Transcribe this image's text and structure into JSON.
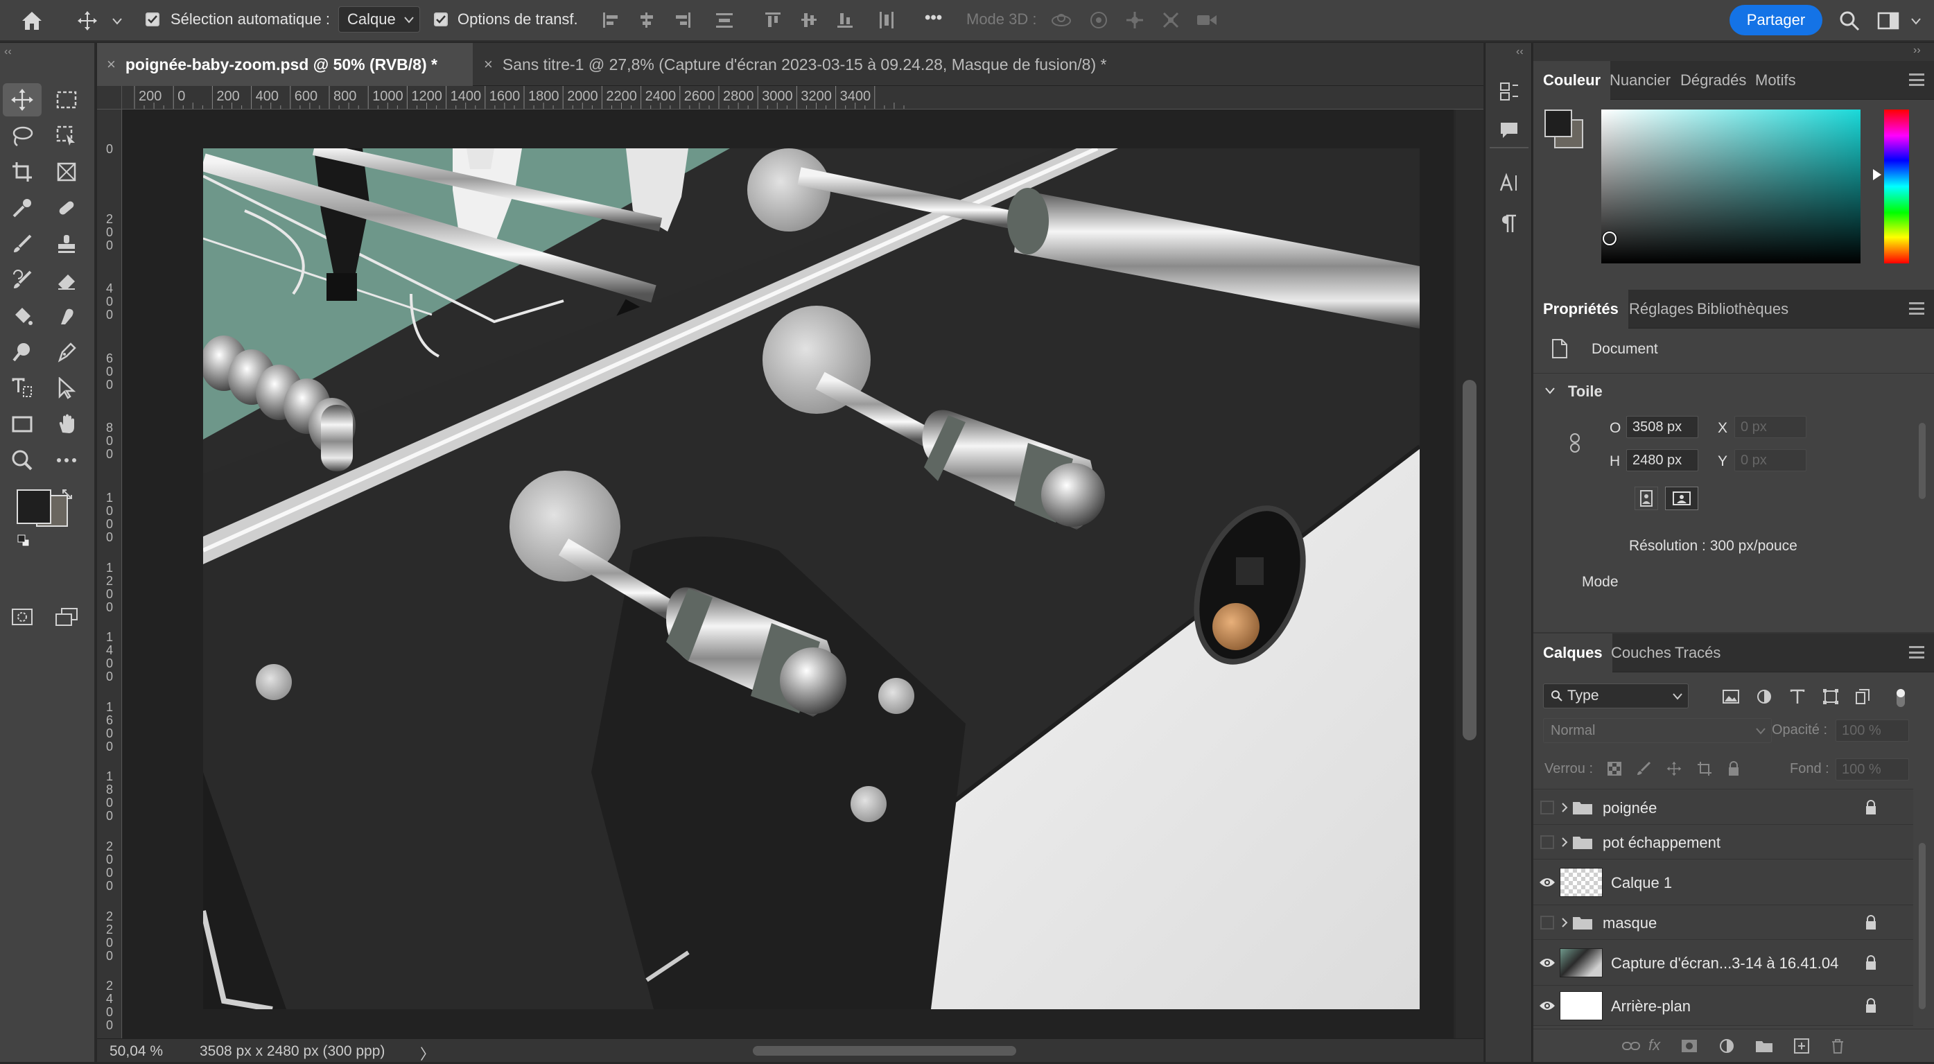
{
  "options_bar": {
    "auto_select_label": "Sélection automatique :",
    "auto_select_value": "Calque",
    "transform_label": "Options de transf.",
    "mode3d_label": "Mode 3D :",
    "share_label": "Partager",
    "more_label": "•••"
  },
  "document_tabs": [
    {
      "close": "×",
      "title": "poignée-baby-zoom.psd @ 50% (RVB/8) *"
    },
    {
      "close": "×",
      "title": "Sans titre-1 @ 27,8% (Capture d'écran 2023-03-15 à 09.24.28, Masque de fusion/8) *"
    }
  ],
  "ruler_h": [
    "200",
    "0",
    "200",
    "400",
    "600",
    "800",
    "1000",
    "1200",
    "1400",
    "1600",
    "1800",
    "2000",
    "2200",
    "2400",
    "2600",
    "2800",
    "3000",
    "3200",
    "3400"
  ],
  "ruler_v": [
    "0",
    "2\n0\n0",
    "4\n0\n0",
    "6\n0\n0",
    "8\n0\n0",
    "1\n0\n0\n0",
    "1\n2\n0\n0",
    "1\n4\n0\n0",
    "1\n6\n0\n0",
    "1\n8\n0\n0",
    "2\n0\n0\n0",
    "2\n2\n0\n0",
    "2\n4\n0\n0"
  ],
  "status": {
    "zoom": "50,04 %",
    "info": "3508 px x 2480 px (300 ppp)",
    "arrow": "〉"
  },
  "color_panel": {
    "tabs": [
      "Couleur",
      "Nuancier",
      "Dégradés",
      "Motifs"
    ]
  },
  "properties_panel": {
    "tabs": [
      "Propriétés",
      "Réglages",
      "Bibliothèques"
    ],
    "document_label": "Document",
    "section_title": "Toile",
    "width_label": "O",
    "width_value": "3508 px",
    "height_label": "H",
    "height_value": "2480 px",
    "x_label": "X",
    "x_placeholder": "0 px",
    "y_label": "Y",
    "y_placeholder": "0 px",
    "resolution": "Résolution : 300 px/pouce",
    "mode_label": "Mode"
  },
  "layers_panel": {
    "tabs": [
      "Calques",
      "Couches",
      "Tracés"
    ],
    "filter_label": "Type",
    "blend_mode": "Normal",
    "opacity_label": "Opacité :",
    "opacity_value": "100 %",
    "lock_label": "Verrou :",
    "fill_label": "Fond :",
    "fill_value": "100 %",
    "fx_label": "fx",
    "layers": [
      {
        "name": "poignée",
        "type": "group",
        "visible": false,
        "locked": true
      },
      {
        "name": "pot échappement",
        "type": "group",
        "visible": false,
        "locked": false
      },
      {
        "name": "Calque 1",
        "type": "layer",
        "visible": true,
        "locked": false
      },
      {
        "name": "masque",
        "type": "group",
        "visible": false,
        "locked": true
      },
      {
        "name": "Capture d'écran...3-14 à 16.41.04",
        "type": "layer",
        "visible": true,
        "locked": true
      },
      {
        "name": "Arrière-plan",
        "type": "layer",
        "visible": true,
        "locked": true
      }
    ]
  },
  "colors": {
    "accent": "#1473e6",
    "foreground": "#1f1f1f",
    "background": "#6a665f"
  }
}
